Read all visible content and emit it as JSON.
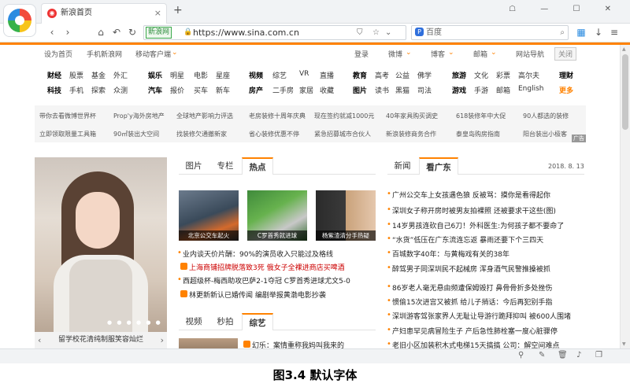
{
  "browser": {
    "tab_title": "新浪首页",
    "tab_close": "×",
    "new_tab": "+",
    "address_badge": "新浪网",
    "address_url": "https://www.sina.com.cn",
    "search_placeholder": "百度",
    "search_provider_initial": "P",
    "lock_glyph": "🔒"
  },
  "topbar": {
    "set_home": "设为首页",
    "mobile": "手机新浪网",
    "client": "移动客户端",
    "login": "登录",
    "weibo": "微博",
    "blog": "博客",
    "mail": "邮箱",
    "nav": "网站导航",
    "close": "关闭"
  },
  "categories": {
    "row1": [
      "财经",
      "股票",
      "基金",
      "外汇",
      "娱乐",
      "明星",
      "电影",
      "星座",
      "视频",
      "综艺",
      "VR",
      "直播",
      "教育",
      "高考",
      "公益",
      "佛学",
      "旅游",
      "文化",
      "彩票",
      "高尔夫",
      "理财"
    ],
    "row2": [
      "科技",
      "手机",
      "探索",
      "众测",
      "汽车",
      "报价",
      "买车",
      "新车",
      "房产",
      "二手房",
      "家居",
      "收藏",
      "图片",
      "读书",
      "黑猫",
      "司法",
      "游戏",
      "手游",
      "邮箱",
      "English",
      "更多"
    ]
  },
  "ads": {
    "row1": [
      "带你去看微博世界杯",
      "Prop'y海外房地产",
      "全球地产影响力评选",
      "老房装修十周年庆典",
      "现在签约就减1000元",
      "40年家具购买调史",
      "618装修年中大促",
      "90人都选的装修"
    ],
    "row2": [
      "立即领取限量工具箱",
      "90㎡装出大空间",
      "找装修欠通撤新家",
      "省心装修优惠不停",
      "紧急招募城市合伙人",
      "新浪装修商务合作",
      "泰皇岛购房指南",
      "阳台装出小极客"
    ],
    "tag": "广告"
  },
  "left": {
    "caption": "留学校花清纯制服笑容灿烂",
    "prev": "‹",
    "next": "›",
    "dots": "● ● ● ● ● ●"
  },
  "middle": {
    "tabs": [
      "图片",
      "专栏",
      "热点"
    ],
    "thumbs": [
      "北京公交车起火",
      "C罗首秀就进球",
      "杨紫渣清分手热疑"
    ],
    "news": [
      "业内谈天价片酬：90%的演员收入只能过及格线",
      "上海商铺招牌脱落致3死  俄女子全裸进商店买啤酒",
      "西超级杯-梅西助攻巴萨2-1夺冠  C罗首秀进球尤文5-0",
      "林更新新认已婚传闻        编剧举报黄渤电影抄袭"
    ],
    "tabs2": [
      "视频",
      "秒拍",
      "综艺"
    ],
    "video_news": "幻乐：案情重称我妈叫我来的"
  },
  "right": {
    "tabs": [
      "新闻",
      "看广东"
    ],
    "date": "2018. 8. 13",
    "news": [
      "广州公交车上女孩遇色狼  反被骂：摸你是看得起你",
      "深圳女子称开房时被男友拍裸照  还被要求干这些(图)",
      "14岁男孩连砍自己6刀！外科医生:为何孩子都不要命了",
      "“水货”低压在广东流连忘返  暴雨还要下个三四天",
      "百城数字40年：与黄梅戏有关的38年",
      "醉驾男子同深圳民不起械房  浑身酒气民警推搡被抓",
      "86岁老人毫无悬由频遭保姆毁打  鼻骨骨折多处挫伤",
      "惯偷15次进宫又被抓  给儿子捎话：今后再犯别手指",
      "深圳游客驾张家界人无耻让导游行跪拜抑叫  被600人围堵",
      "产妇患罕见病冒险生子  产后急性肺栓塞一度心脏骤停",
      "老旧小区加装积木式电梯15天搞搞  公司：解空间难点"
    ]
  },
  "figure_caption": "图3.4  默认字体"
}
